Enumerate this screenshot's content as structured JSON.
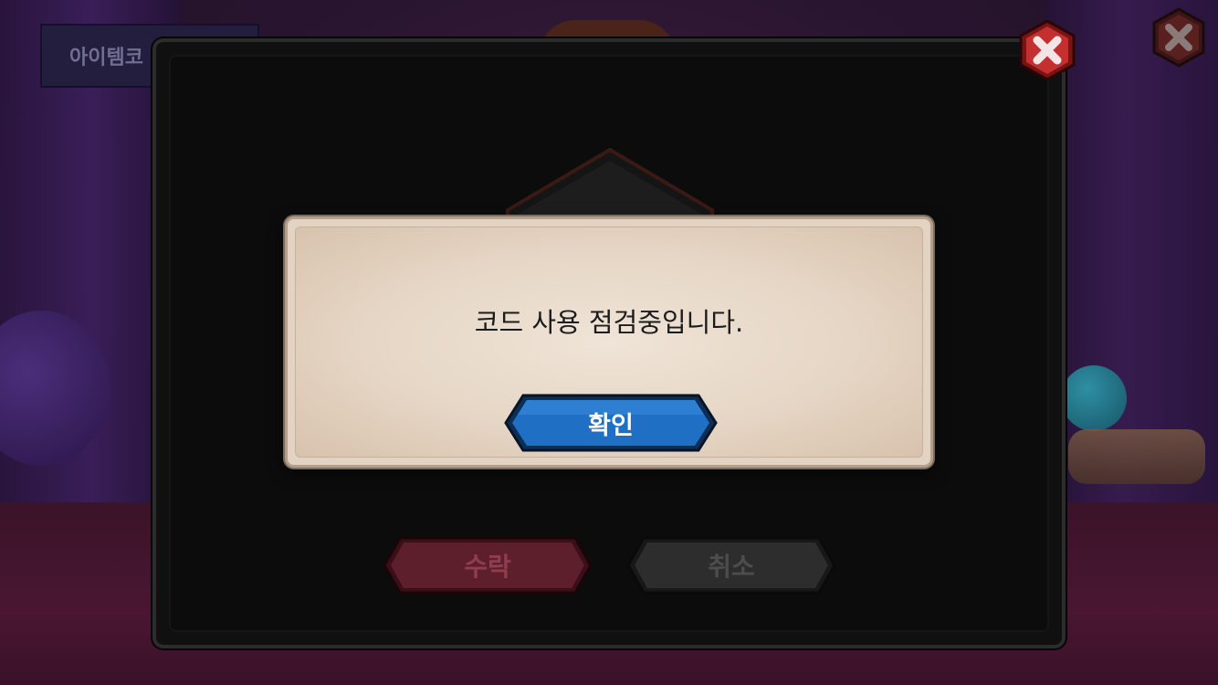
{
  "background": {
    "tab_label": "아이템코"
  },
  "dialog": {
    "accept_label": "수락",
    "cancel_label": "취소"
  },
  "popup": {
    "message": "코드 사용 점검중입니다.",
    "confirm_label": "확인"
  },
  "colors": {
    "confirm_button": "#1f6fc4",
    "accept_button": "#5e1f2c",
    "cancel_button": "#2d2d2d",
    "close_button": "#b82a2a",
    "popup_background": "#e6d6c5"
  },
  "icons": {
    "close": "close-icon"
  }
}
